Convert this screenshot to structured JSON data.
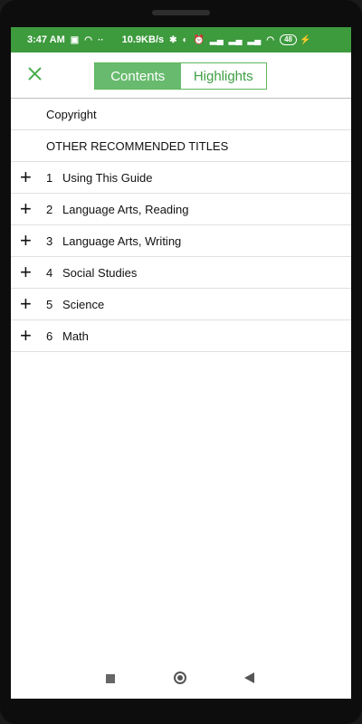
{
  "status_bar": {
    "time": "3:47 AM",
    "speed": "10.9KB/s",
    "battery": "48"
  },
  "toolbar": {
    "tabs": [
      {
        "label": "Contents",
        "active": true
      },
      {
        "label": "Highlights",
        "active": false
      }
    ]
  },
  "contents": {
    "items": [
      {
        "num": "",
        "label": "Copyright",
        "expandable": false
      },
      {
        "num": "",
        "label": "OTHER RECOMMENDED TITLES",
        "expandable": false
      },
      {
        "num": "1",
        "label": "Using This Guide",
        "expandable": true
      },
      {
        "num": "2",
        "label": "Language Arts, Reading",
        "expandable": true
      },
      {
        "num": "3",
        "label": "Language Arts, Writing",
        "expandable": true
      },
      {
        "num": "4",
        "label": "Social Studies",
        "expandable": true
      },
      {
        "num": "5",
        "label": "Science",
        "expandable": true
      },
      {
        "num": "6",
        "label": "Math",
        "expandable": true
      }
    ]
  },
  "colors": {
    "status_bar": "#3d9a3d",
    "accent": "#5cb85c"
  }
}
